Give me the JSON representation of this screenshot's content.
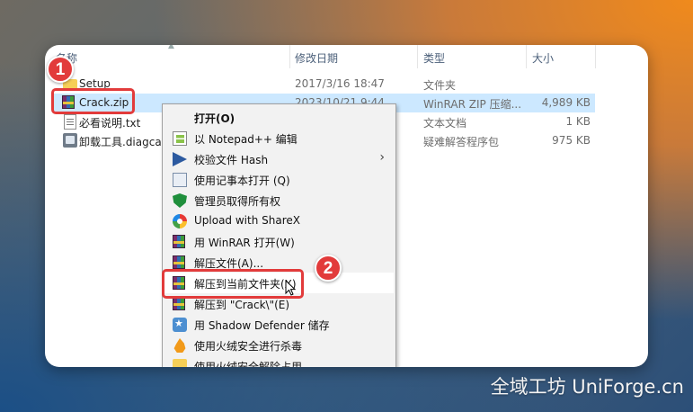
{
  "columns": {
    "name": "名称",
    "date": "修改日期",
    "type": "类型",
    "size": "大小"
  },
  "files": [
    {
      "name": "Setup",
      "date": "2017/3/16 18:47",
      "type": "文件夹",
      "size": ""
    },
    {
      "name": "Crack.zip",
      "date": "2023/10/21 9:44",
      "type": "WinRAR ZIP 压缩...",
      "size": "4,989 KB"
    },
    {
      "name": "必看说明.txt",
      "date": "",
      "type": "文本文档",
      "size": "1 KB"
    },
    {
      "name": "卸载工具.diagcab",
      "date": "",
      "type": "疑难解答程序包",
      "size": "975 KB"
    }
  ],
  "context_menu": {
    "items": [
      {
        "label": "打开(O)",
        "icon": "none"
      },
      {
        "label": "以 Notepad++ 编辑",
        "icon": "notepadpp-icon"
      },
      {
        "label": "校验文件 Hash",
        "icon": "powershell-icon",
        "submenu": true
      },
      {
        "label": "使用记事本打开 (Q)",
        "icon": "document-icon"
      },
      {
        "label": "管理员取得所有权",
        "icon": "shield-icon"
      },
      {
        "label": "Upload with ShareX",
        "icon": "sharex-icon"
      },
      {
        "label": "用 WinRAR 打开(W)",
        "icon": "winrar-icon"
      },
      {
        "label": "解压文件(A)...",
        "icon": "winrar-icon"
      },
      {
        "label": "解压到当前文件夹(X)",
        "icon": "winrar-icon",
        "highlighted": true
      },
      {
        "label": "解压到 \"Crack\\\"(E)",
        "icon": "winrar-icon"
      },
      {
        "label": "用 Shadow Defender 储存",
        "icon": "shadow-defender-icon"
      },
      {
        "label": "使用火绒安全进行杀毒",
        "icon": "huorong-icon"
      },
      {
        "label": "使用火绒安全解除占用",
        "icon": "folder-icon"
      }
    ],
    "submenu_arrow": "›"
  },
  "callouts": {
    "step1": "1",
    "step2": "2",
    "color": "#e23b3b"
  },
  "selection_color": "#cce8ff",
  "watermark": "全域工坊 UniForge.cn"
}
